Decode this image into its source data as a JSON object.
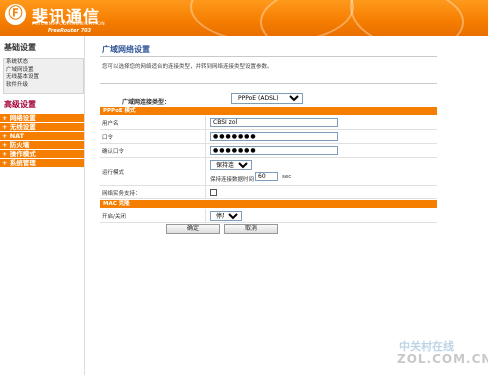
{
  "header": {
    "logo_glyph": "Ⓕ",
    "brand": "斐讯通信",
    "brand_en": "PHICOMM COMMUNICATION",
    "model": "FreeRouter 703"
  },
  "sidebar": {
    "basic_title": "基础设置",
    "basic_items": [
      "系统状态",
      "广域网设置",
      "无线基本设置",
      "软件升级"
    ],
    "advanced_title": "高级设置",
    "advanced_items": [
      "+ 网络设置",
      "+ 无线设置",
      "+ NAT",
      "+ 防火墙",
      "+ 操作模式",
      "+ 系统管理"
    ]
  },
  "main": {
    "title": "广域网络设置",
    "description": "您可以选择您的网络适合的连接类型，并转到网络连接类型设置参数。",
    "connection_type_label": "广域网连接类型：",
    "connection_type_value": "PPPoE (ADSL)",
    "pppoe_section": "PPPoE 模式",
    "username_label": "用户名",
    "username_value": "CBSI zol",
    "password_label": "口令",
    "password_value": "●●●●●●●",
    "confirm_label": "确认口令",
    "confirm_value": "●●●●●●●",
    "run_mode_label": "运行模式",
    "run_mode_value": "保持连接",
    "idle_label": "保持连接数据时间",
    "idle_value": "60",
    "idle_unit": "sec",
    "passthrough_label": "网络实务支持：",
    "mac_section": "MAC 克隆",
    "mac_enable_label": "开启/关闭",
    "mac_enable_value": "停用",
    "ok_button": "确定",
    "cancel_button": "取消"
  },
  "watermark": {
    "cn": "中关村在线",
    "en": "ZOL.COM.CN"
  },
  "colors": {
    "accent": "#f57d00",
    "title_blue": "#2f5597",
    "advanced_red": "#a5003a"
  }
}
